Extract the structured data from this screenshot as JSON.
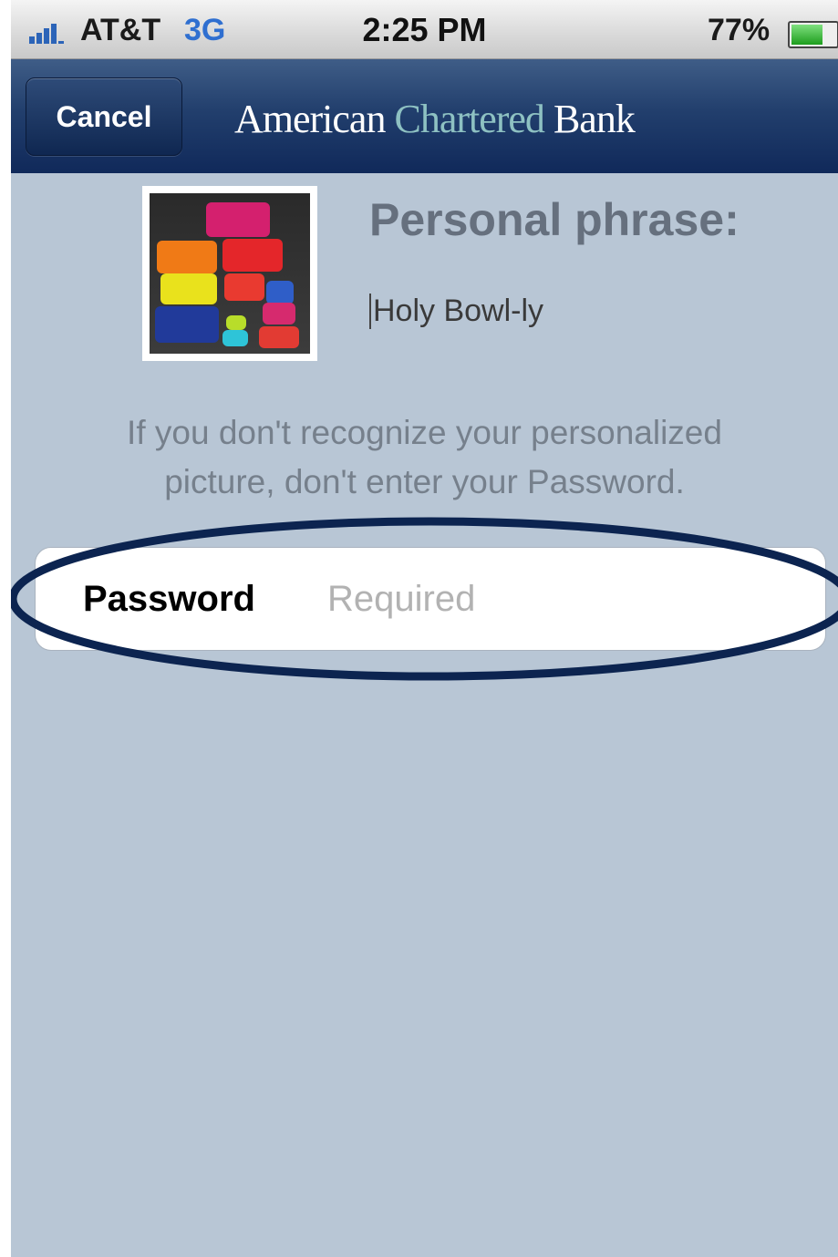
{
  "status_bar": {
    "carrier": "AT&T",
    "network": "3G",
    "time": "2:25 PM",
    "battery_percent": "77%",
    "battery_level": 0.77
  },
  "nav": {
    "cancel_label": "Cancel",
    "brand": {
      "part1": "American ",
      "part2": "Chartered",
      "part3": " Bank"
    }
  },
  "security": {
    "phrase_title": "Personal phrase:",
    "phrase_value": "Holy Bowl-ly",
    "picture_icon": "stacked-bowls-image",
    "warning_line1": "If you don't recognize your personalized",
    "warning_line2": "picture, don't enter your Password."
  },
  "password_field": {
    "label": "Password",
    "value": "",
    "placeholder": "Required"
  },
  "colors": {
    "background": "#b8c6d5",
    "nav": "#1b3563",
    "highlight_ring": "#0c2450"
  }
}
